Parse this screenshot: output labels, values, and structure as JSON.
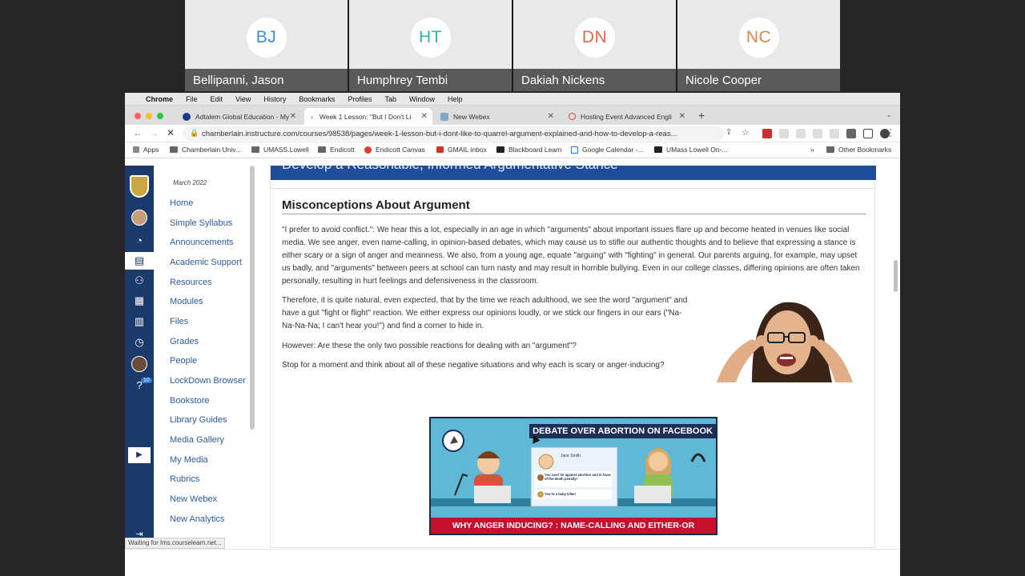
{
  "participants": [
    {
      "initials": "BJ",
      "name": "Bellipanni, Jason",
      "color": "#3a8fd6"
    },
    {
      "initials": "HT",
      "name": "Humphrey Tembi",
      "color": "#2fb6a4"
    },
    {
      "initials": "DN",
      "name": "Dakiah Nickens",
      "color": "#e06a4a"
    },
    {
      "initials": "NC",
      "name": "Nicole Cooper",
      "color": "#e0864a"
    }
  ],
  "menubar": {
    "app": "Chrome",
    "items": [
      "File",
      "Edit",
      "View",
      "History",
      "Bookmarks",
      "Profiles",
      "Tab",
      "Window",
      "Help"
    ]
  },
  "tabs": [
    {
      "title": "Adtalem Global Education - My"
    },
    {
      "title": "Week 1 Lesson: \"But I Don't Li"
    },
    {
      "title": "New Webex"
    },
    {
      "title": "Hosting Event Advanced Engli"
    }
  ],
  "address_bar": {
    "url": "chamberlain.instructure.com/courses/98538/pages/week-1-lesson-but-i-dont-like-to-quarrel-argument-explained-and-how-to-develop-a-reas..."
  },
  "bookmarks": {
    "items": [
      "Apps",
      "Chamberlain Univ...",
      "UMASS.Lowell",
      "Endicott",
      "Endicott Canvas",
      "GMAIL inbox",
      "Blackboard Learn",
      "Google Calendar -...",
      "UMass Lowell On-..."
    ],
    "overflow": "»",
    "other": "Other Bookmarks"
  },
  "global_nav": {
    "notification_count": "10"
  },
  "course_nav": {
    "term": "March 2022",
    "links": [
      "Home",
      "Simple Syllabus",
      "Announcements",
      "Academic Support",
      "Resources",
      "Modules",
      "Files",
      "Grades",
      "People",
      "LockDown Browser",
      "Bookstore",
      "Library Guides",
      "Media Gallery",
      "My Media",
      "Rubrics",
      "New Webex",
      "New Analytics"
    ]
  },
  "content": {
    "banner_title": "Develop a Reasonable, Informed Argumentative Stance",
    "heading": "Misconceptions About Argument",
    "paragraph1": "\"I prefer to avoid conflict.\": We hear this a lot, especially in an age in which \"arguments\" about important issues flare up and become heated in venues like social media. We see anger, even name-calling, in opinion-based debates, which may cause us to stifle our authentic thoughts and to believe that expressing a stance is either scary or a sign of anger and meanness. We also, from a young age, equate \"arguing\" with \"fighting\" in general. Our parents arguing, for example, may upset us badly, and \"arguments\" between peers at school can turn nasty and may result in horrible bullying. Even in our college classes, differing opinions are often taken personally, resulting in hurt feelings and defensiveness in the classroom.",
    "paragraph2": "Therefore, it is quite natural, even expected, that by the time we reach adulthood, we see the word \"argument\" and have a gut \"fight or flight\" reaction. We either express our opinions loudly, or we stick our fingers in our ears (\"Na-Na-Na-Na; I can't hear you!\") and find a corner to hide in.",
    "paragraph3": "However: Are these the only two possible reactions for dealing with an \"argument\"?",
    "paragraph4": "Stop for a moment and think about all of these negative situations and why each is scary or anger-inducing?",
    "infographic": {
      "title": "DEBATE OVER ABORTION ON FACEBOOK",
      "post_name": "Jane Smith",
      "comment1": "You can't be against abortion and in favor of the death penalty!",
      "comment2": "You're a baby killer!",
      "caption": "WHY ANGER INDUCING? : NAME-CALLING AND EITHER-OR"
    }
  },
  "status_bar": "Waiting for lms.courselearn.net..."
}
